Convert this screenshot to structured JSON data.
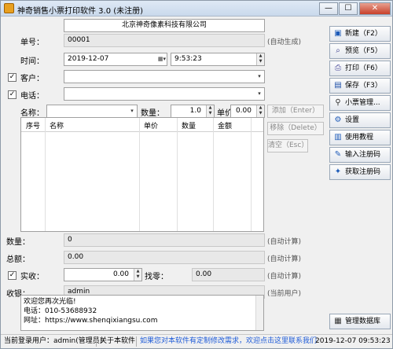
{
  "window": {
    "title": "神奇销售小票打印软件 3.0 (未注册)",
    "minimize_glyph": "—",
    "maximize_glyph": "☐",
    "close_glyph": "✕"
  },
  "form": {
    "company_name": "北京神奇像素科技有限公司",
    "order_no": {
      "label": "单号：",
      "value": "00001",
      "hint": "(自动生成)"
    },
    "time": {
      "label": "时间：",
      "date": "2019-12-07",
      "clock": "9:53:23"
    },
    "customer": {
      "label": "客户：",
      "value": "",
      "checked": true
    },
    "phone": {
      "label": "电话：",
      "value": "",
      "checked": true
    },
    "item_entry": {
      "name_label": "名称：",
      "name_value": "",
      "qty_label": "数量：",
      "qty_value": "1.0",
      "price_label": "单价：",
      "price_value": "0.00"
    },
    "grid_buttons": {
      "add": "添加（Enter）",
      "remove": "移除（Delete）",
      "clear": "清空（Esc）"
    },
    "grid": {
      "columns": [
        "序号",
        "名称",
        "单价",
        "数量",
        "金额"
      ],
      "rows": []
    },
    "summary": {
      "qty": {
        "label": "数量：",
        "value": "0",
        "hint": "(自动计算)"
      },
      "total": {
        "label": "总额：",
        "value": "0.00",
        "hint": "(自动计算)"
      },
      "received": {
        "label": "实收：",
        "value": "0.00",
        "checked": true
      },
      "change": {
        "label": "找零：",
        "value": "0.00",
        "hint": "(自动计算)"
      },
      "cashier": {
        "label": "收银：",
        "value": "admin",
        "hint": "(当前用户)"
      }
    },
    "memo_lines": [
      "欢迎您再次光临!",
      "电话：010-53688932",
      "网址：https://www.shenqixiangsu.com"
    ]
  },
  "sidebar": {
    "buttons": [
      {
        "label": "新建（F2）",
        "icon": "new-icon",
        "glyph": "▣",
        "color": "#1e5bb8"
      },
      {
        "label": "预览（F5）",
        "icon": "preview-icon",
        "glyph": "⌕",
        "color": "#3a3a8a"
      },
      {
        "label": "打印（F6）",
        "icon": "print-icon",
        "glyph": "⎙",
        "color": "#4a4a9a"
      },
      {
        "label": "保存（F3）",
        "icon": "save-icon",
        "glyph": "▤",
        "color": "#1e4fa8"
      },
      {
        "label": "小票管理...",
        "icon": "magnifier-icon",
        "glyph": "⚲",
        "color": "#333"
      },
      {
        "label": "设置",
        "icon": "gear-icon",
        "glyph": "⚙",
        "color": "#1e5bb8"
      },
      {
        "label": "使用教程",
        "icon": "book-icon",
        "glyph": "▥",
        "color": "#1e5bb8"
      },
      {
        "label": "输入注册码",
        "icon": "key-icon",
        "glyph": "✎",
        "color": "#1e5bb8"
      },
      {
        "label": "获取注册码",
        "icon": "get-key-icon",
        "glyph": "✦",
        "color": "#1e5bb8"
      }
    ],
    "db_button": {
      "label": "管理数据库",
      "icon": "database-icon",
      "glyph": "▦"
    }
  },
  "statusbar": {
    "user": "当前登录用户：admin(管理员)",
    "about": "关于本软件",
    "notice": "如果您对本软件有定制修改需求，欢迎点击这里联系我们",
    "datetime": "2019-12-07 09:53:23"
  }
}
